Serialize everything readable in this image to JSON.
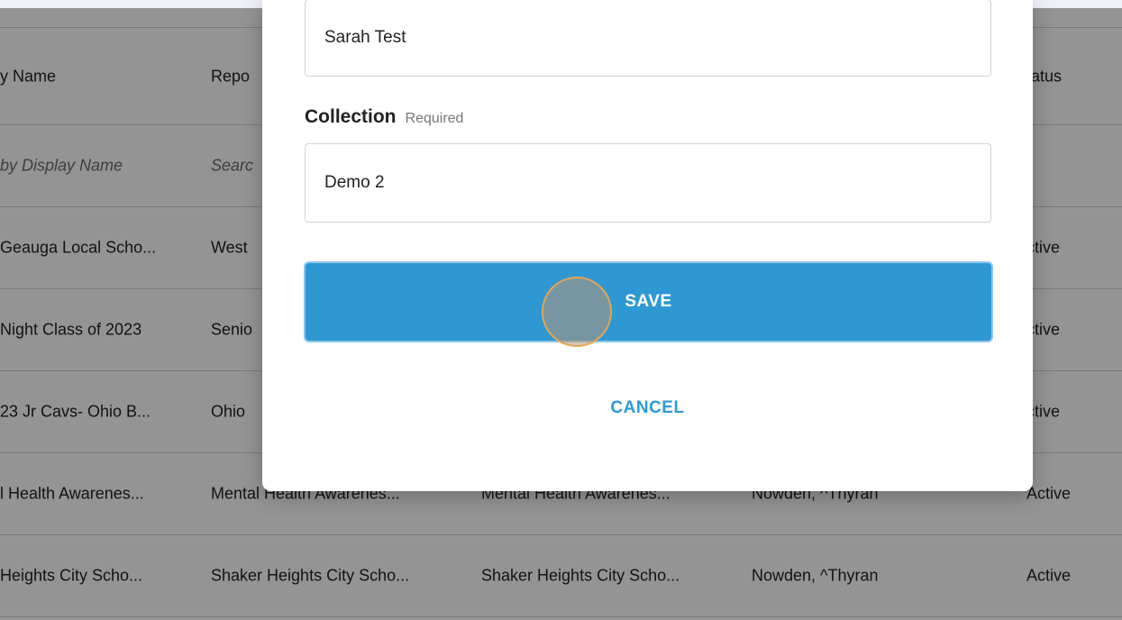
{
  "table": {
    "headers": [
      "y Name",
      "Repo",
      "",
      "",
      "tatus"
    ],
    "search_placeholders": [
      "by Display Name",
      "Searc"
    ],
    "rows": [
      [
        "Geauga Local Scho...",
        "West",
        "",
        "",
        "ctive"
      ],
      [
        "Night Class of 2023",
        "Senio",
        "",
        "",
        "ctive"
      ],
      [
        "23 Jr Cavs- Ohio B...",
        "Ohio",
        "",
        "",
        "ctive"
      ],
      [
        "l Health Awarenes...",
        "Mental Health Awarenes...",
        "Mental Health Awarenes...",
        "Nowden, ^Thyran",
        "Active"
      ],
      [
        "Heights City Scho...",
        "Shaker Heights City Scho...",
        "Shaker Heights City Scho...",
        "Nowden, ^Thyran",
        "Active"
      ]
    ]
  },
  "modal": {
    "name_value": "Sarah Test",
    "collection_label": "Collection",
    "collection_required": "Required",
    "collection_value": "Demo 2",
    "save_label": "SAVE",
    "cancel_label": "CANCEL"
  },
  "colors": {
    "primary": "#2f98d3",
    "link": "#2a9ad8",
    "overlay": "rgba(0,0,0,0.42)"
  }
}
